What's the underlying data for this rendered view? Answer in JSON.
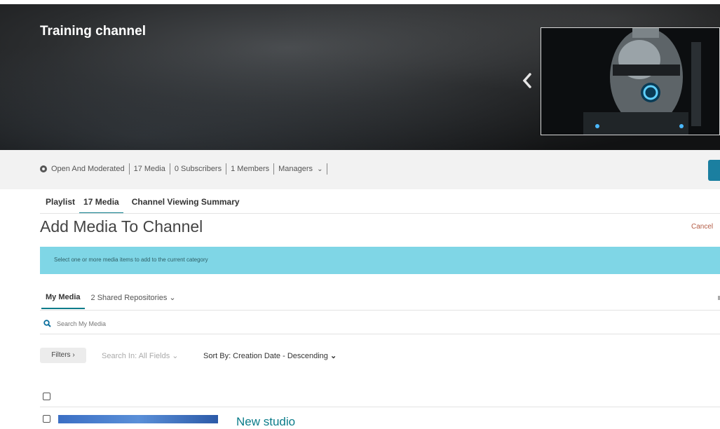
{
  "banner": {
    "title": "Training channel"
  },
  "meta": {
    "moderation": "Open And Moderated",
    "media": "17  Media",
    "subscribers": "0  Subscribers",
    "members": "1  Members",
    "managers": "Managers"
  },
  "tabs": [
    {
      "label": "Playlist"
    },
    {
      "label": "17 Media"
    },
    {
      "label": "Channel Viewing Summary"
    }
  ],
  "page": {
    "title": "Add Media To Channel",
    "cancel": "Cancel",
    "info": "Select one or more media items to add to the current category"
  },
  "media_tabs": {
    "my_media": "My Media",
    "shared": "2 Shared Repositories"
  },
  "search": {
    "placeholder": "Search My Media"
  },
  "filters": {
    "button": "Filters",
    "search_in": "Search In: All Fields",
    "sort_by": "Sort By: Creation Date - Descending"
  },
  "list": {
    "first_item_title": "New studio"
  },
  "colors": {
    "accent": "#0b7c8a",
    "info_bg": "#7fd6e6",
    "cancel": "#b35b44"
  }
}
